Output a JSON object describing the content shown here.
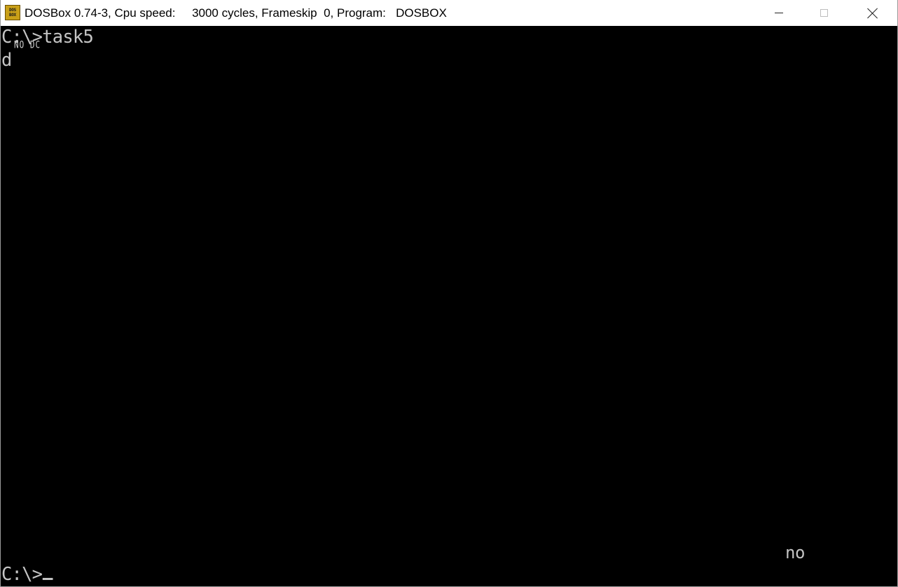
{
  "window": {
    "title": "DOSBox 0.74-3, Cpu speed:     3000 cycles, Frameskip  0, Program:   DOSBOX",
    "icon": "dosbox-app-icon",
    "icon_text_top": "DOS",
    "icon_text_bottom": "BOX",
    "controls": {
      "minimize": "minimize-icon",
      "maximize": "maximize-icon",
      "close": "close-icon"
    }
  },
  "console": {
    "lines": {
      "prompt1": "C:\\>task5",
      "small_output": "NO DC",
      "output_d": "d",
      "output_no": "no",
      "prompt2": "C:\\>"
    }
  },
  "colors": {
    "console_bg": "#000000",
    "console_text": "#c4c4c4",
    "titlebar_bg": "#ffffff",
    "icon_accent": "#c9a018"
  }
}
